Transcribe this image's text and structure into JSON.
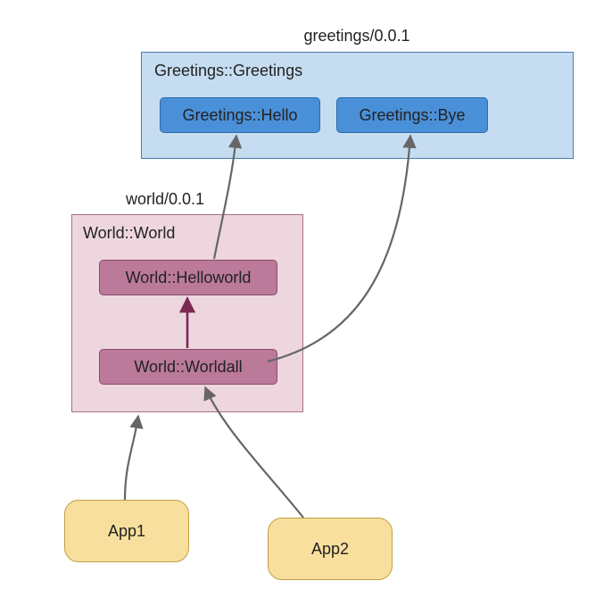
{
  "packages": {
    "greetings": {
      "title": "greetings/0.0.1",
      "module": "Greetings::Greetings",
      "targets": {
        "hello": "Greetings::Hello",
        "bye": "Greetings::Bye"
      }
    },
    "world": {
      "title": "world/0.0.1",
      "module": "World::World",
      "targets": {
        "helloworld": "World::Helloworld",
        "worldall": "World::Worldall"
      }
    }
  },
  "apps": {
    "app1": "App1",
    "app2": "App2"
  },
  "edges": [
    {
      "from": "app1",
      "to": "world-pkg"
    },
    {
      "from": "app2",
      "to": "worldall"
    },
    {
      "from": "worldall",
      "to": "helloworld"
    },
    {
      "from": "helloworld",
      "to": "hello"
    },
    {
      "from": "worldall",
      "to": "bye"
    }
  ]
}
